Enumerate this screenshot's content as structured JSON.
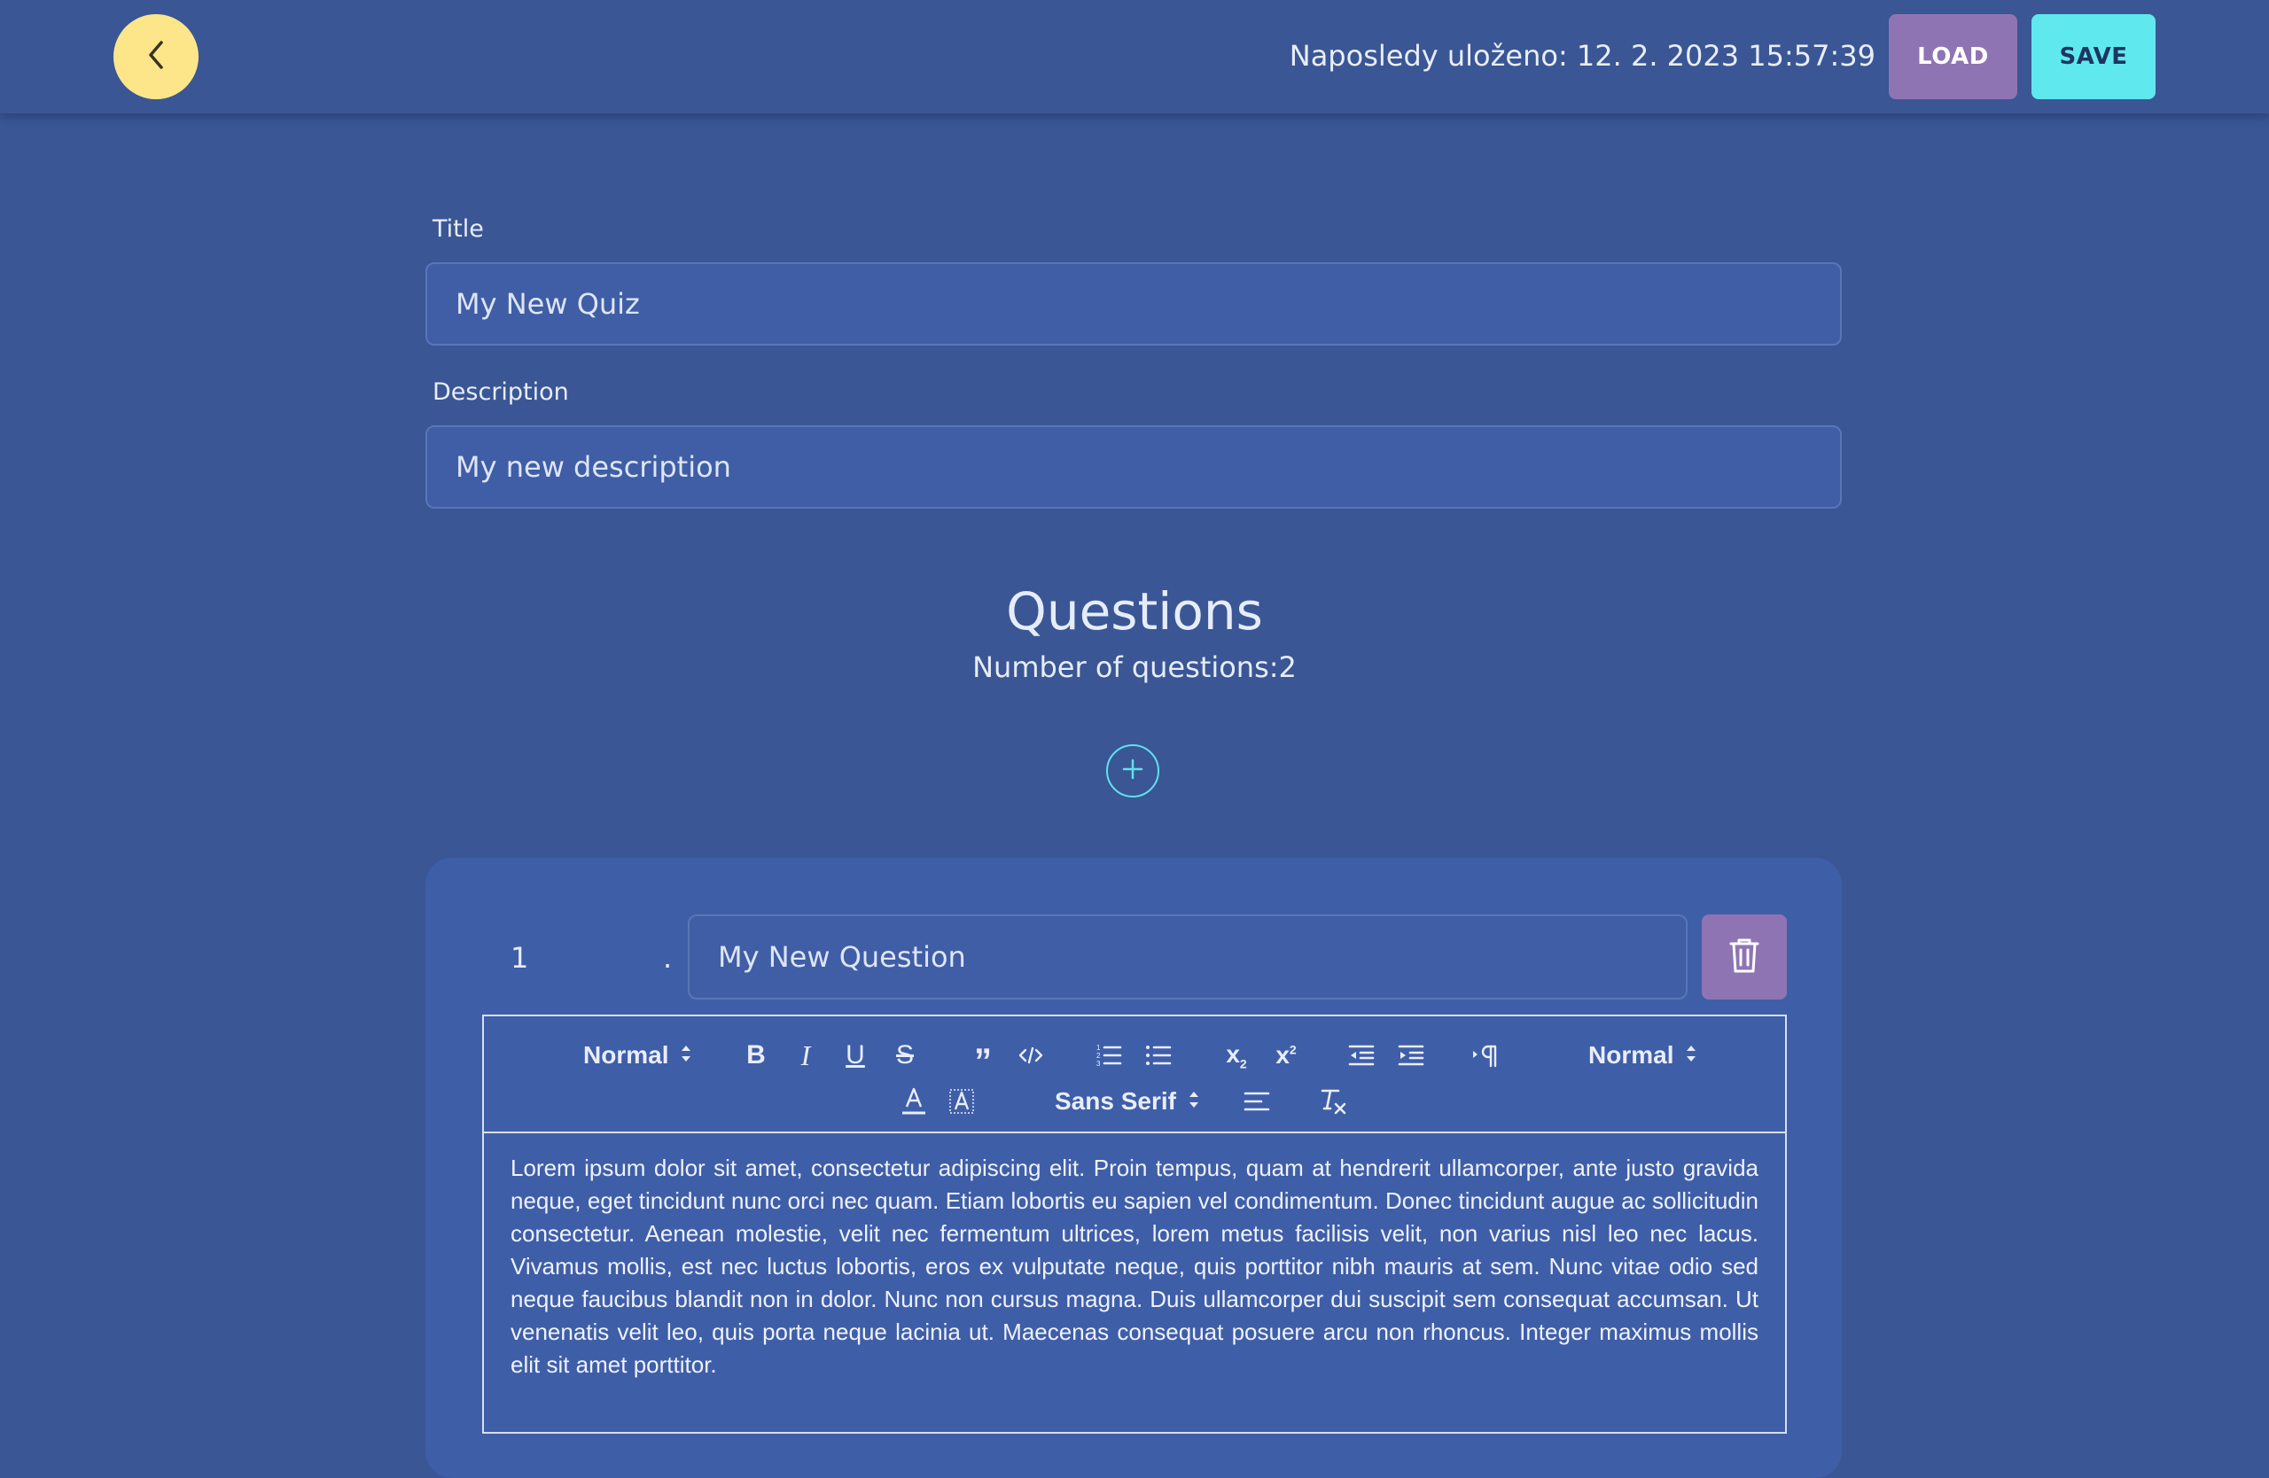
{
  "header": {
    "last_saved": "Naposledy uloženo: 12. 2. 2023 15:57:39",
    "load_label": "LOAD",
    "save_label": "SAVE"
  },
  "form": {
    "title_label": "Title",
    "title_value": "My New Quiz",
    "description_label": "Description",
    "description_value": "My new description"
  },
  "questions": {
    "heading": "Questions",
    "count_text": "Number of questions:2",
    "items": [
      {
        "number": "1",
        "separator": ".",
        "title": "My New Question",
        "body": "Lorem ipsum dolor sit amet, consectetur adipiscing elit. Proin tempus, quam at hendrerit ullamcorper, ante justo gravida neque, eget tincidunt nunc orci nec quam. Etiam lobortis eu sapien vel condimentum. Donec tincidunt augue ac sollicitudin consectetur. Aenean molestie, velit nec fermentum ultrices, lorem metus facilisis velit, non varius nisl leo nec lacus. Vivamus mollis, est nec luctus lobortis, eros ex vulputate neque, quis porttitor nibh mauris at sem. Nunc vitae odio sed neque faucibus blandit non in dolor. Nunc non cursus magna. Duis ullamcorper dui suscipit sem consequat accumsan. Ut venenatis velit leo, quis porta neque lacinia ut. Maecenas consequat posuere arcu non rhoncus. Integer maximus mollis elit sit amet porttitor."
      }
    ]
  },
  "toolbar": {
    "header_select": "Normal",
    "size_select": "Normal",
    "font_select": "Sans Serif",
    "icons": [
      "bold-icon",
      "italic-icon",
      "underline-icon",
      "strike-icon",
      "blockquote-icon",
      "code-icon",
      "ordered-list-icon",
      "bullet-list-icon",
      "subscript-icon",
      "superscript-icon",
      "outdent-icon",
      "indent-icon",
      "direction-icon",
      "text-color-icon",
      "background-color-icon",
      "align-icon",
      "clear-format-icon"
    ]
  },
  "colors": {
    "background": "#3a5694",
    "back_button": "#fde68a",
    "load_button": "#8f74b3",
    "save_button": "#5fe9ef",
    "accent": "#5fe0f0"
  }
}
